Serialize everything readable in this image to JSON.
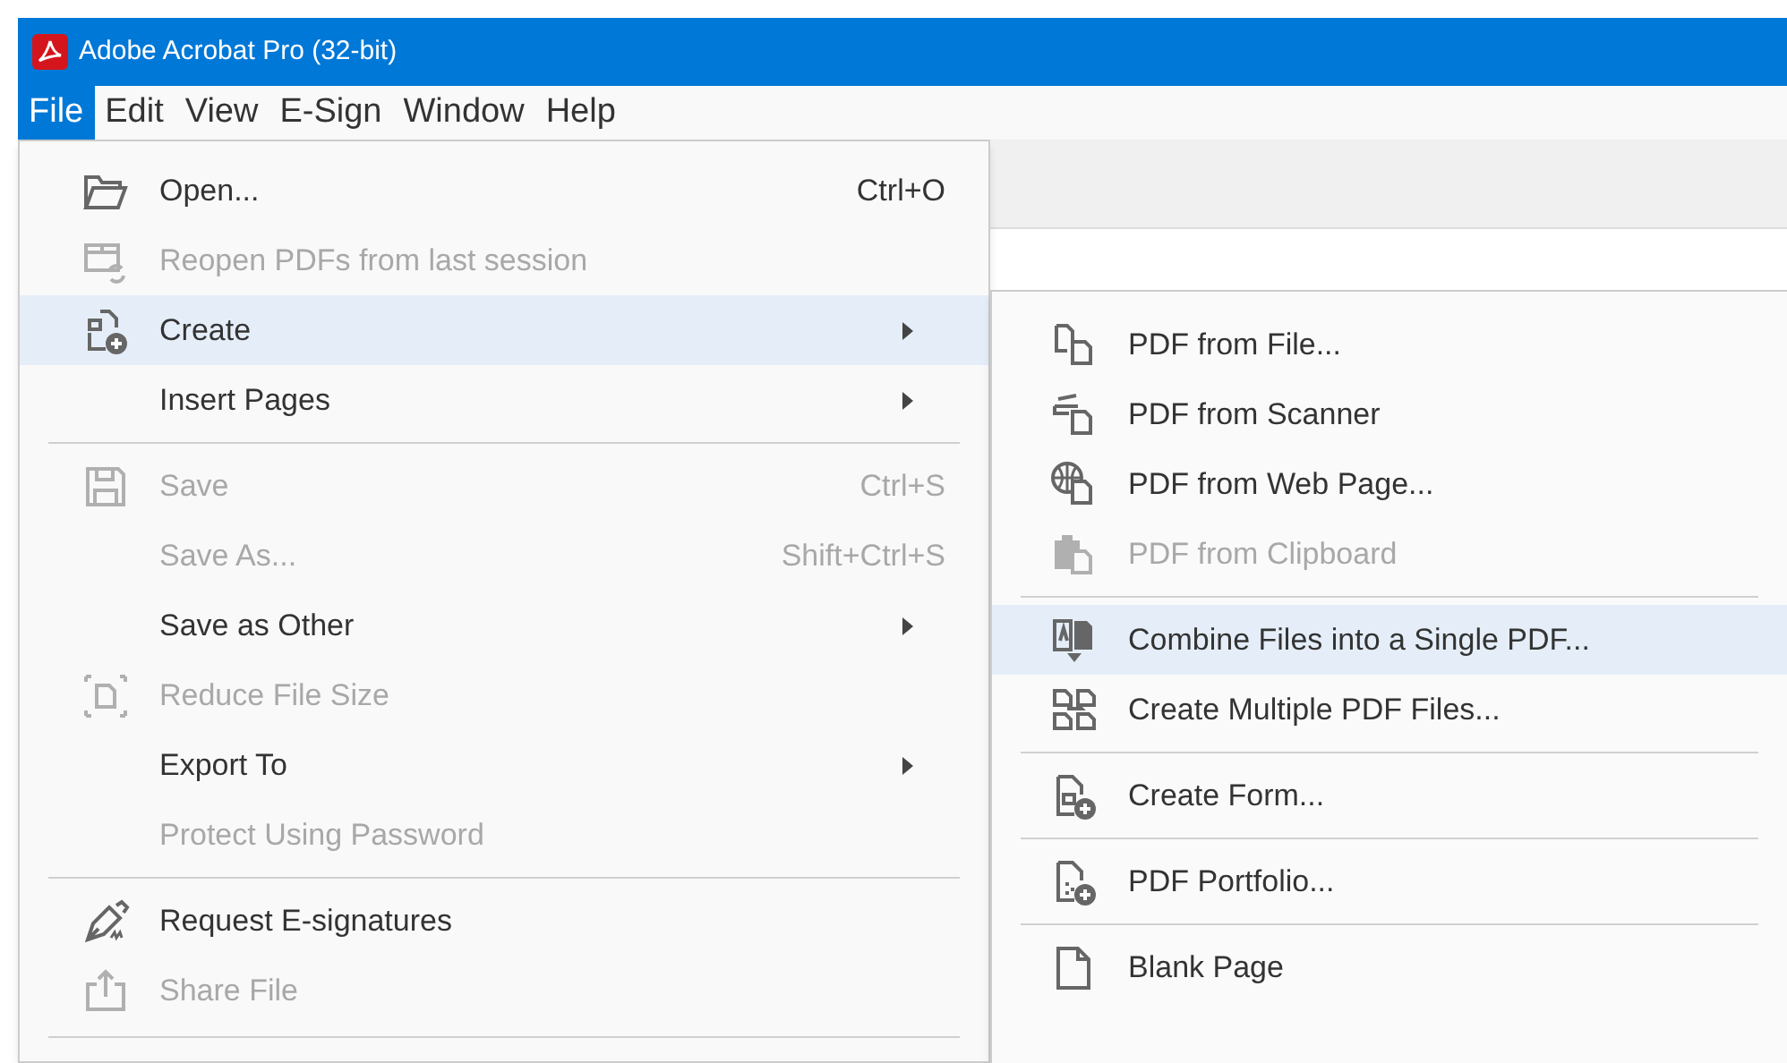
{
  "window": {
    "title": "Adobe Acrobat Pro (32-bit)"
  },
  "menu_bar": [
    {
      "label": "File",
      "selected": true
    },
    {
      "label": "Edit",
      "selected": false
    },
    {
      "label": "View",
      "selected": false
    },
    {
      "label": "E-Sign",
      "selected": false
    },
    {
      "label": "Window",
      "selected": false
    },
    {
      "label": "Help",
      "selected": false
    }
  ],
  "file_menu": [
    {
      "kind": "item",
      "label": "Open...",
      "shortcut": "Ctrl+O",
      "disabled": false,
      "selected": false,
      "submenu": false
    },
    {
      "kind": "item",
      "label": "Reopen PDFs from last session",
      "disabled": true,
      "selected": false,
      "submenu": false
    },
    {
      "kind": "item",
      "label": "Create",
      "disabled": false,
      "selected": true,
      "submenu": true
    },
    {
      "kind": "item",
      "label": "Insert Pages",
      "disabled": false,
      "selected": false,
      "submenu": true
    },
    {
      "kind": "separator"
    },
    {
      "kind": "item",
      "label": "Save",
      "shortcut": "Ctrl+S",
      "disabled": true,
      "selected": false,
      "submenu": false
    },
    {
      "kind": "item",
      "label": "Save As...",
      "shortcut": "Shift+Ctrl+S",
      "disabled": true,
      "selected": false,
      "submenu": false
    },
    {
      "kind": "item",
      "label": "Save as Other",
      "disabled": false,
      "selected": false,
      "submenu": true
    },
    {
      "kind": "item",
      "label": "Reduce File Size",
      "disabled": true,
      "selected": false,
      "submenu": false
    },
    {
      "kind": "item",
      "label": "Export To",
      "disabled": false,
      "selected": false,
      "submenu": true
    },
    {
      "kind": "item",
      "label": "Protect Using Password",
      "disabled": true,
      "selected": false,
      "submenu": false
    },
    {
      "kind": "separator"
    },
    {
      "kind": "item",
      "label": "Request E-signatures",
      "disabled": false,
      "selected": false,
      "submenu": false
    },
    {
      "kind": "item",
      "label": "Share File",
      "disabled": true,
      "selected": false,
      "submenu": false
    }
  ],
  "create_submenu": [
    {
      "kind": "item",
      "label": "PDF from File...",
      "disabled": false,
      "selected": false
    },
    {
      "kind": "item",
      "label": "PDF from Scanner",
      "disabled": false,
      "selected": false
    },
    {
      "kind": "item",
      "label": "PDF from Web Page...",
      "disabled": false,
      "selected": false
    },
    {
      "kind": "item",
      "label": "PDF from Clipboard",
      "disabled": true,
      "selected": false
    },
    {
      "kind": "separator"
    },
    {
      "kind": "item",
      "label": "Combine Files into a Single PDF...",
      "disabled": false,
      "selected": true
    },
    {
      "kind": "item",
      "label": "Create Multiple PDF Files...",
      "disabled": false,
      "selected": false
    },
    {
      "kind": "separator"
    },
    {
      "kind": "item",
      "label": "Create Form...",
      "disabled": false,
      "selected": false
    },
    {
      "kind": "separator"
    },
    {
      "kind": "item",
      "label": "PDF Portfolio...",
      "disabled": false,
      "selected": false
    },
    {
      "kind": "separator"
    },
    {
      "kind": "item",
      "label": "Blank Page",
      "disabled": false,
      "selected": false
    }
  ]
}
